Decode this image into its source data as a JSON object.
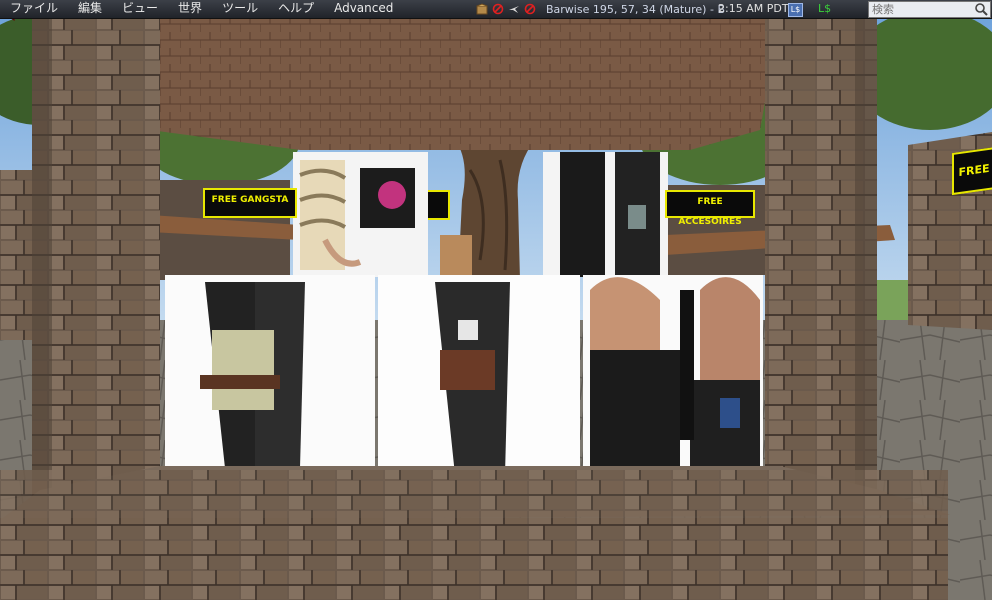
{
  "menu": {
    "items": [
      "ファイル",
      "編集",
      "ビュー",
      "世界",
      "ツール",
      "ヘルプ",
      "Advanced"
    ]
  },
  "status": {
    "location": "Barwise 195, 57, 34 (Mature) - B",
    "time": "2:15 AM PDT",
    "currency_button": "L$",
    "balance": "L$"
  },
  "search": {
    "placeholder": "検索",
    "value": ""
  },
  "world": {
    "signs": {
      "gangsta": "FREE GANGSTA",
      "accesoires": "FREE ACCESOIRES",
      "right": "FREE"
    }
  },
  "colors": {
    "sign_text": "#f1f100",
    "sign_bg": "#0a0a0a",
    "menu_bg": "#2b2e34",
    "balance": "#3ad13a"
  },
  "icons": [
    "inventory-box-icon",
    "no-build-icon",
    "no-fly-icon",
    "no-script-icon",
    "search-icon",
    "back-arrow-icon"
  ]
}
